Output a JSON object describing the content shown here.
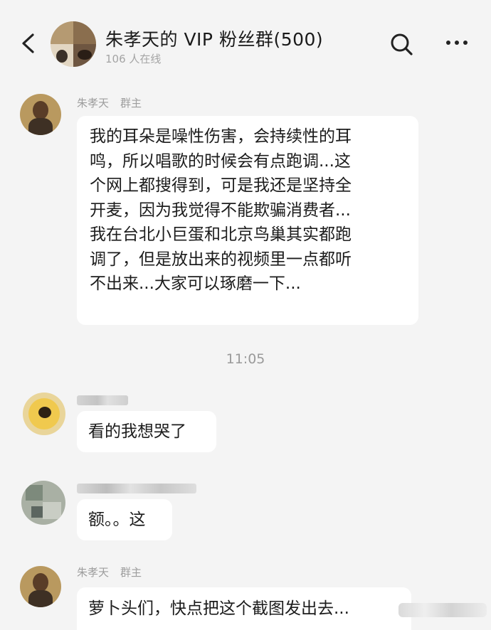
{
  "header": {
    "title": "朱孝天的 VIP 粉丝群(500)",
    "online": "106 人在线",
    "icons": {
      "back": "chevron-left-icon",
      "search": "search-icon",
      "more": "more-dots-icon"
    }
  },
  "messages": [
    {
      "sender": "朱孝天",
      "role": "群主",
      "lines": [
        "我的耳朵是噪性伤害，会持续性的耳",
        "鸣，所以唱歌的时候会有点跑调...这",
        "个网上都搜得到，可是我还是坚持全",
        "开麦，因为我觉得不能欺骗消费者...",
        "我在台北小巨蛋和北京鸟巢其实都跑",
        "调了，但是放出来的视频里一点都听",
        "不出来...大家可以琢磨一下..."
      ]
    },
    {
      "text": "看的我想哭了"
    },
    {
      "text": "额。。这"
    },
    {
      "sender": "朱孝天",
      "role": "群主",
      "text": "萝卜头们，快点把这个截图发出去..."
    }
  ],
  "timestamp": "11:05",
  "colors": {
    "background": "#f4f4f4",
    "bubble": "#ffffff",
    "secondary_text": "#9d9d9d"
  }
}
